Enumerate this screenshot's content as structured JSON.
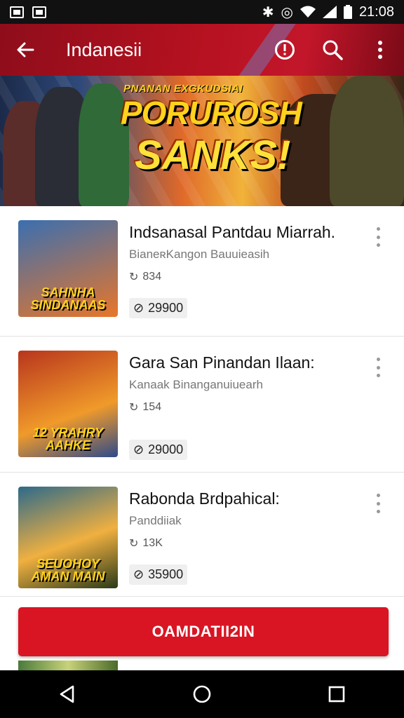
{
  "status_bar": {
    "time": "21:08",
    "icons": [
      "image-icon",
      "notification-icon",
      "bluetooth-icon",
      "alarm-icon",
      "wifi-icon",
      "signal-icon",
      "battery-icon"
    ]
  },
  "app_bar": {
    "title": "Indanesii",
    "actions": [
      "info-icon",
      "search-icon",
      "more-vert-icon"
    ]
  },
  "banner": {
    "tagline": "PNANAN EXGKUDSIAI",
    "title_line1": "PORUROSH",
    "title_line2": "SANKS!"
  },
  "items": [
    {
      "name": "Indsanasal Pantdau Miarrah.",
      "subtitle": "BianeʀKangon Bauuieasih",
      "meta": "834",
      "price": "29900",
      "thumb_text": "SAHNHA SINDANAAS",
      "thumb_colors": [
        "#3a6fb0",
        "#e8762a"
      ]
    },
    {
      "name": "Gara San Pinandan Ilaan:",
      "subtitle": "Kanaak Binanganuiuearh",
      "meta": "154",
      "price": "29000",
      "thumb_text": "12 YRAHRY AAHKE",
      "thumb_colors": [
        "#b8351d",
        "#f09a2a"
      ]
    },
    {
      "name": "Rabonda Brdpahical:",
      "subtitle": "Panddiiak",
      "meta": "13K",
      "price": "35900",
      "thumb_text": "SEUOHOY AMAN MAIN",
      "thumb_colors": [
        "#2d6a8a",
        "#f0b040"
      ]
    }
  ],
  "cta": {
    "label": "OAMDATII2IN"
  },
  "accent_color": "#d91523"
}
